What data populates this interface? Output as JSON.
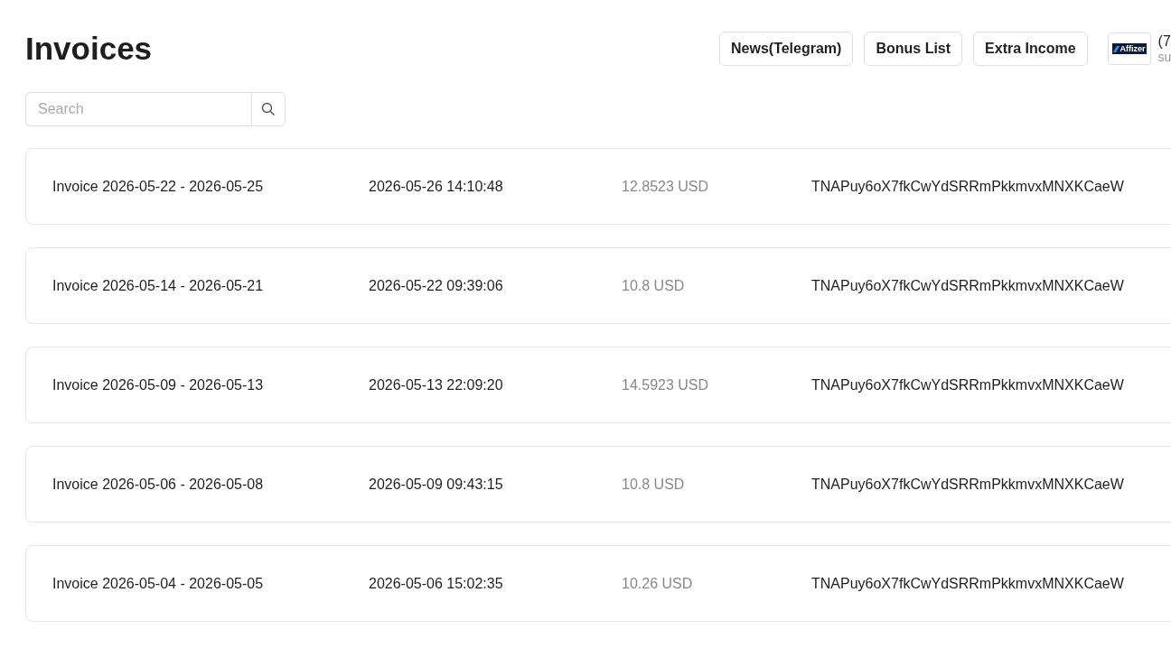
{
  "title": "Invoices",
  "header_buttons": [
    "News(Telegram)",
    "Bonus List",
    "Extra Income"
  ],
  "account": {
    "logo_text": "Affizer",
    "name": "(7",
    "subtitle": "su"
  },
  "search": {
    "placeholder": "Search"
  },
  "invoices": [
    {
      "name": "Invoice 2026-05-22 - 2026-05-25",
      "date": "2026-05-26 14:10:48",
      "amount": "12.8523 USD",
      "wallet": "TNAPuy6oX7fkCwYdSRRmPkkmvxMNXKCaeW"
    },
    {
      "name": "Invoice 2026-05-14 - 2026-05-21",
      "date": "2026-05-22 09:39:06",
      "amount": "10.8 USD",
      "wallet": "TNAPuy6oX7fkCwYdSRRmPkkmvxMNXKCaeW"
    },
    {
      "name": "Invoice 2026-05-09 - 2026-05-13",
      "date": "2026-05-13 22:09:20",
      "amount": "14.5923 USD",
      "wallet": "TNAPuy6oX7fkCwYdSRRmPkkmvxMNXKCaeW"
    },
    {
      "name": "Invoice 2026-05-06 - 2026-05-08",
      "date": "2026-05-09 09:43:15",
      "amount": "10.8 USD",
      "wallet": "TNAPuy6oX7fkCwYdSRRmPkkmvxMNXKCaeW"
    },
    {
      "name": "Invoice 2026-05-04 - 2026-05-05",
      "date": "2026-05-06 15:02:35",
      "amount": "10.26 USD",
      "wallet": "TNAPuy6oX7fkCwYdSRRmPkkmvxMNXKCaeW"
    }
  ]
}
